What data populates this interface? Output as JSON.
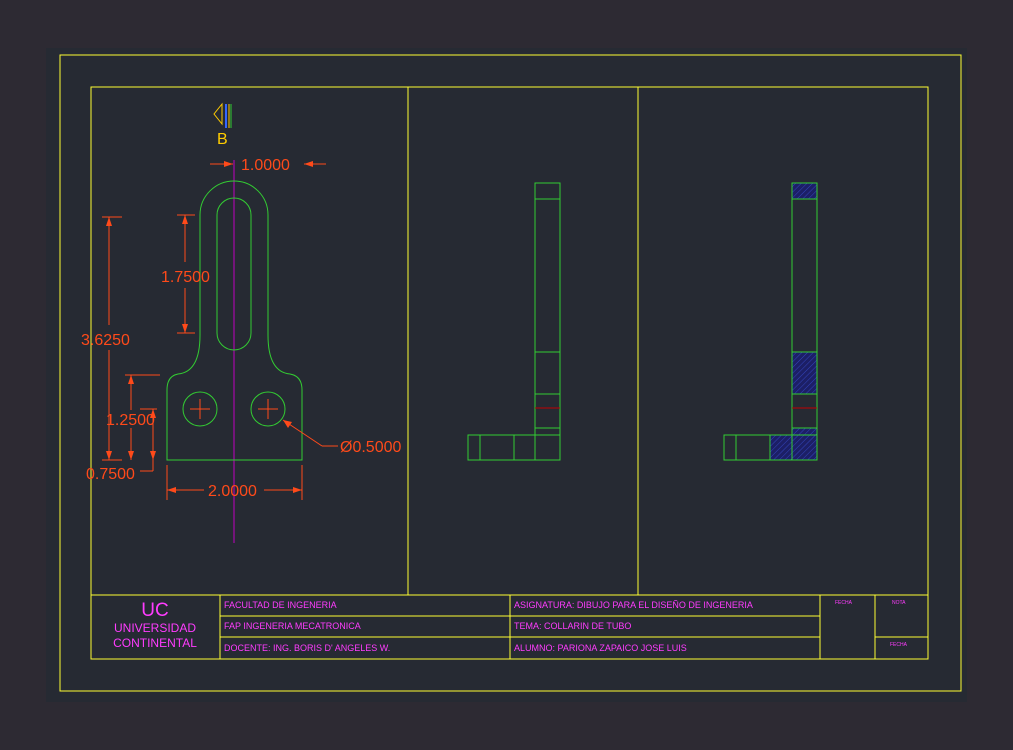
{
  "colors": {
    "frame": "#ffff33",
    "part": "#33cc33",
    "dimension": "#ff4a1a",
    "centerline": "#c000c0",
    "hatch": "#2222aa",
    "titleblock_text": "#ff3cff",
    "section_marker_yellow": "#ffcc00",
    "section_marker_blue": "#3366ff"
  },
  "section_marker": {
    "label": "B"
  },
  "dimensions": {
    "top_width": "1.0000",
    "slot_length": "1.7500",
    "total_height": "3.6250",
    "hole_height": "1.2500",
    "bottom_offset": "0.7500",
    "base_width": "2.0000",
    "hole_diameter": "Ø0.5000"
  },
  "title_block": {
    "logo_abbr": "UC",
    "logo_line1": "UNIVERSIDAD",
    "logo_line2": "CONTINENTAL",
    "faculty": "FACULTAD DE INGENERIA",
    "program": "FAP INGENERIA MECATRONICA",
    "teacher": "DOCENTE: ING. BORIS D' ANGELES W.",
    "subject": "ASIGNATURA: DIBUJO PARA EL DISEÑO DE INGENERIA",
    "topic": "TEMA: COLLARIN DE TUBO",
    "student": "ALUMNO: PARIONA ZAPAICO JOSE LUIS",
    "date_label": "FECHA",
    "grade_label": "NOTA",
    "date_label_2": "FECHA"
  }
}
